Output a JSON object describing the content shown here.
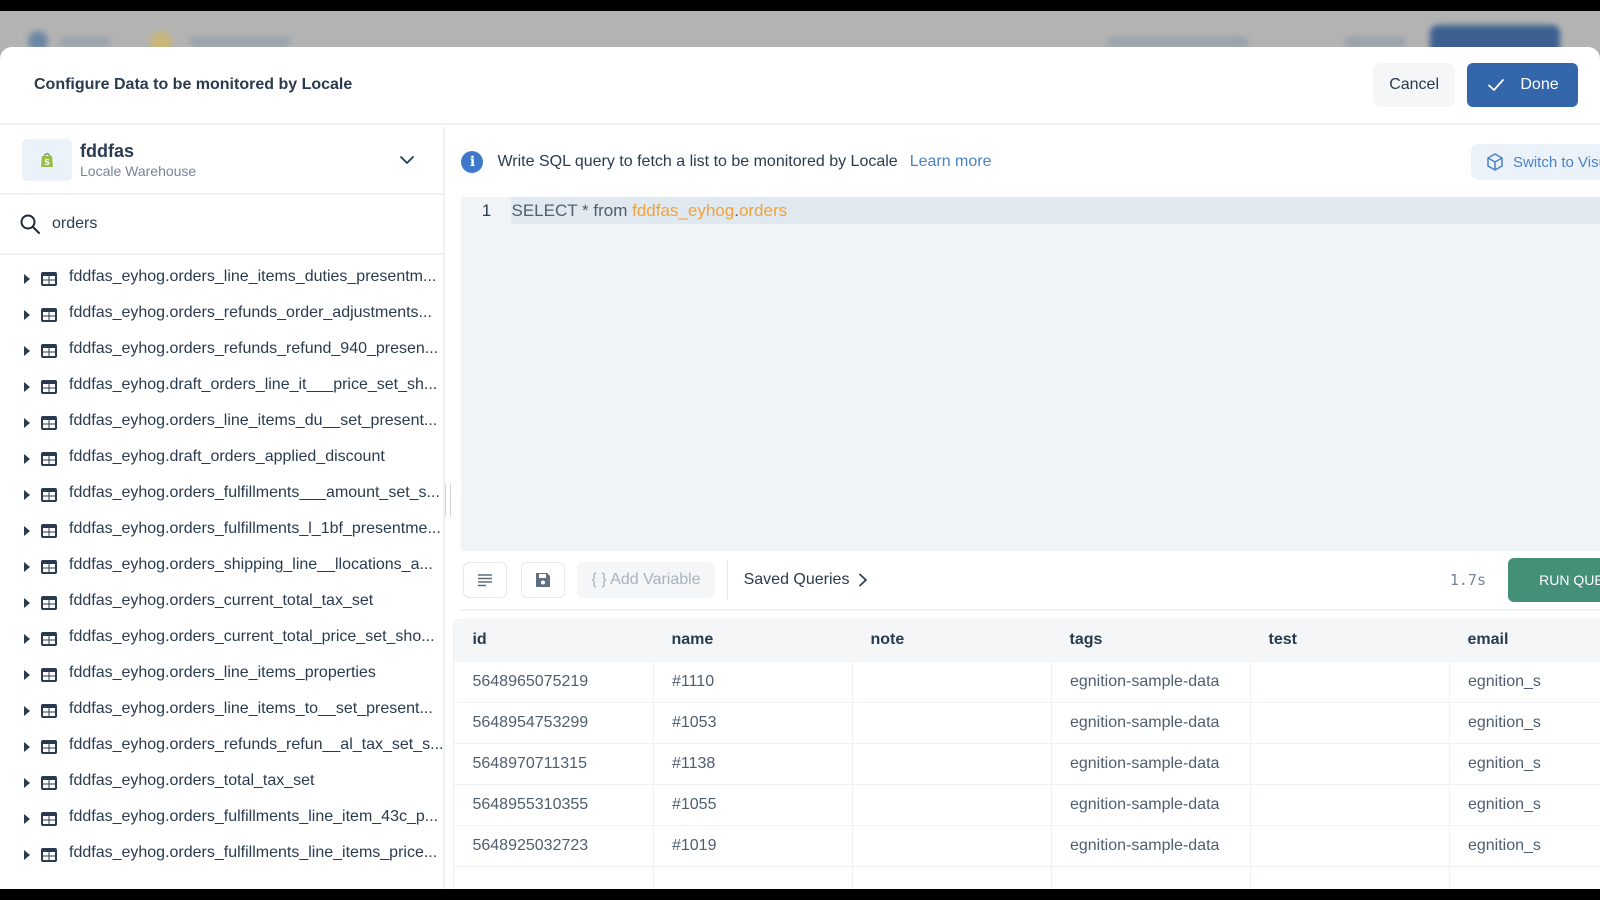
{
  "modal": {
    "title": "Configure Data to be monitored by Locale",
    "cancel_label": "Cancel",
    "done_label": "Done"
  },
  "source": {
    "name": "fddfas",
    "subtitle": "Locale Warehouse",
    "icon": "shopify-bag-icon"
  },
  "search": {
    "value": "orders",
    "icon": "search-icon"
  },
  "tables": [
    "fddfas_eyhog.orders_line_items_duties_presentm...",
    "fddfas_eyhog.orders_refunds_order_adjustments...",
    "fddfas_eyhog.orders_refunds_refund_940_presen...",
    "fddfas_eyhog.draft_orders_line_it___price_set_sh...",
    "fddfas_eyhog.orders_line_items_du__set_present...",
    "fddfas_eyhog.draft_orders_applied_discount",
    "fddfas_eyhog.orders_fulfillments___amount_set_s...",
    "fddfas_eyhog.orders_fulfillments_l_1bf_presentme...",
    "fddfas_eyhog.orders_shipping_line__llocations_a...",
    "fddfas_eyhog.orders_current_total_tax_set",
    "fddfas_eyhog.orders_current_total_price_set_sho...",
    "fddfas_eyhog.orders_line_items_properties",
    "fddfas_eyhog.orders_line_items_to__set_present...",
    "fddfas_eyhog.orders_refunds_refun__al_tax_set_s...",
    "fddfas_eyhog.orders_total_tax_set",
    "fddfas_eyhog.orders_fulfillments_line_item_43c_p...",
    "fddfas_eyhog.orders_fulfillments_line_items_price..."
  ],
  "info": {
    "text": "Write SQL query to fetch a list to be monitored by Locale",
    "link": "Learn more",
    "switch_label": "Switch to Visual Editor"
  },
  "editor": {
    "line_number": "1",
    "keyword": "SELECT * from ",
    "schema": "fddfas_eyhog",
    "dot": ".",
    "table": "orders"
  },
  "toolbar": {
    "add_variable": "{ } Add Variable",
    "saved_queries": "Saved Queries",
    "elapsed": "1.7s",
    "run_label": "RUN QUERY"
  },
  "results": {
    "columns": [
      "id",
      "name",
      "note",
      "tags",
      "test",
      "email"
    ],
    "rows": [
      [
        "5648965075219",
        "#1110",
        "",
        "egnition-sample-data",
        "",
        "egnition_s"
      ],
      [
        "5648954753299",
        "#1053",
        "",
        "egnition-sample-data",
        "",
        "egnition_s"
      ],
      [
        "5648970711315",
        "#1138",
        "",
        "egnition-sample-data",
        "",
        "egnition_s"
      ],
      [
        "5648955310355",
        "#1055",
        "",
        "egnition-sample-data",
        "",
        "egnition_s"
      ],
      [
        "5648925032723",
        "#1019",
        "",
        "egnition-sample-data",
        "",
        "egnition_s"
      ],
      [
        "",
        "",
        "",
        "",
        "",
        ""
      ]
    ]
  },
  "colors": {
    "primary": "#3366aa",
    "run": "#438f77",
    "link": "#4a82c8",
    "sql_identifier": "#f0a23c"
  }
}
